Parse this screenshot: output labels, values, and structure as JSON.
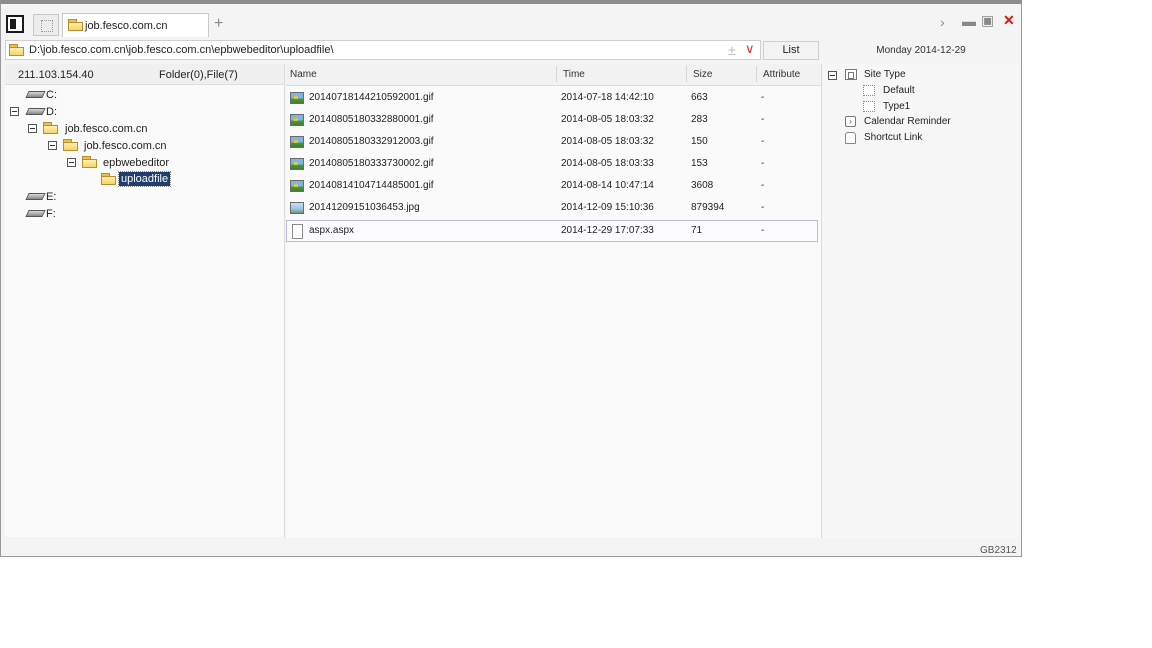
{
  "tab": {
    "label": "job.fesco.com.cn"
  },
  "address": {
    "path": "D:\\job.fesco.com.cn\\job.fesco.com.cn\\epbwebeditor\\uploadfile\\"
  },
  "list_button": "List",
  "date": "Monday 2014-12-29",
  "left_header": {
    "ip": "211.103.154.40",
    "counts": "Folder(0),File(7)"
  },
  "tree": {
    "c": "C:",
    "d": "D:",
    "site1": "job.fesco.com.cn",
    "site2": "job.fesco.com.cn",
    "editor": "epbwebeditor",
    "upload": "uploadfile",
    "e": "E:",
    "f": "F:"
  },
  "columns": {
    "name": "Name",
    "time": "Time",
    "size": "Size",
    "attr": "Attribute"
  },
  "files": [
    {
      "name": "20140718144210592001.gif",
      "time": "2014-07-18 14:42:10",
      "size": "663",
      "attr": "-"
    },
    {
      "name": "20140805180332880001.gif",
      "time": "2014-08-05 18:03:32",
      "size": "283",
      "attr": "-"
    },
    {
      "name": "20140805180332912003.gif",
      "time": "2014-08-05 18:03:32",
      "size": "150",
      "attr": "-"
    },
    {
      "name": "20140805180333730002.gif",
      "time": "2014-08-05 18:03:33",
      "size": "153",
      "attr": "-"
    },
    {
      "name": "20140814104714485001.gif",
      "time": "2014-08-14 10:47:14",
      "size": "3608",
      "attr": "-"
    },
    {
      "name": "20141209151036453.jpg",
      "time": "2014-12-09 15:10:36",
      "size": "879394",
      "attr": "-"
    },
    {
      "name": "aspx.aspx",
      "time": "2014-12-29 17:07:33",
      "size": "71",
      "attr": "-"
    }
  ],
  "right_tree": {
    "site_type": "Site Type",
    "default": "Default",
    "type1": "Type1",
    "calendar": "Calendar Reminder",
    "shortcut": "Shortcut Link"
  },
  "status": "GB2312"
}
